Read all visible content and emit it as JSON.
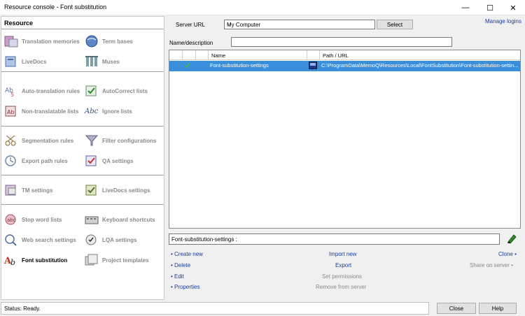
{
  "window": {
    "title": "Resource console - Font substitution",
    "min_glyph": "—",
    "max_glyph": "☐",
    "close_glyph": "✕"
  },
  "left": {
    "header": "Resource",
    "items": [
      {
        "label": "Translation memories",
        "icon": "translation-memories-icon"
      },
      {
        "label": "Term bases",
        "icon": "term-bases-icon"
      },
      {
        "label": "LiveDocs",
        "icon": "livedocs-icon"
      },
      {
        "label": "Muses",
        "icon": "muses-icon"
      },
      {
        "label": "Auto-translation rules",
        "icon": "auto-translation-icon"
      },
      {
        "label": "AutoCorrect lists",
        "icon": "autocorrect-icon"
      },
      {
        "label": "Non-translatable lists",
        "icon": "non-translatable-icon"
      },
      {
        "label": "Ignore lists",
        "icon": "ignore-lists-icon"
      },
      {
        "label": "Segmentation rules",
        "icon": "segmentation-icon"
      },
      {
        "label": "Filter configurations",
        "icon": "filter-icon"
      },
      {
        "label": "Export path rules",
        "icon": "export-path-icon"
      },
      {
        "label": "QA settings",
        "icon": "qa-settings-icon"
      },
      {
        "label": "TM settings",
        "icon": "tm-settings-icon"
      },
      {
        "label": "LiveDocs settings",
        "icon": "livedocs-settings-icon"
      },
      {
        "label": "Stop word lists",
        "icon": "stop-word-icon"
      },
      {
        "label": "Keyboard shortcuts",
        "icon": "keyboard-icon"
      },
      {
        "label": "Web search settings",
        "icon": "web-search-icon"
      },
      {
        "label": "LQA settings",
        "icon": "lqa-icon"
      },
      {
        "label": "Font substitution",
        "icon": "font-substitution-icon"
      },
      {
        "label": "Project templates",
        "icon": "project-templates-icon"
      }
    ]
  },
  "top": {
    "server_url_label": "Server URL",
    "server_value": "My Computer",
    "select_label": "Select",
    "manage_logins": "Manage logins",
    "filter_label": "Name/description"
  },
  "grid": {
    "headers": {
      "name": "Name",
      "path": "Path / URL"
    },
    "rows": [
      {
        "name": "Font-substitution-settings",
        "path": "C:\\ProgramData\\MemoQ\\Resources\\Local\\FontSubstitution\\Font-substitution-settin..."
      }
    ]
  },
  "detail": {
    "name_value": "Font-substitution-settings :"
  },
  "actions": {
    "create_new": "• Create new",
    "delete": "• Delete",
    "edit": "• Edit",
    "properties": "• Properties",
    "import_new": "Import new",
    "export": "Export",
    "set_permissions": "Set permissions",
    "remove_from_server": "Remove from server",
    "clone": "Clone •",
    "share_on_server": "Share on server •"
  },
  "status": {
    "text": "Status: Ready."
  },
  "buttons": {
    "close": "Close",
    "help": "Help"
  },
  "colors": {
    "link": "#1b3ca0",
    "selection": "#3a8fdc",
    "disabled": "#8a8a8a"
  }
}
